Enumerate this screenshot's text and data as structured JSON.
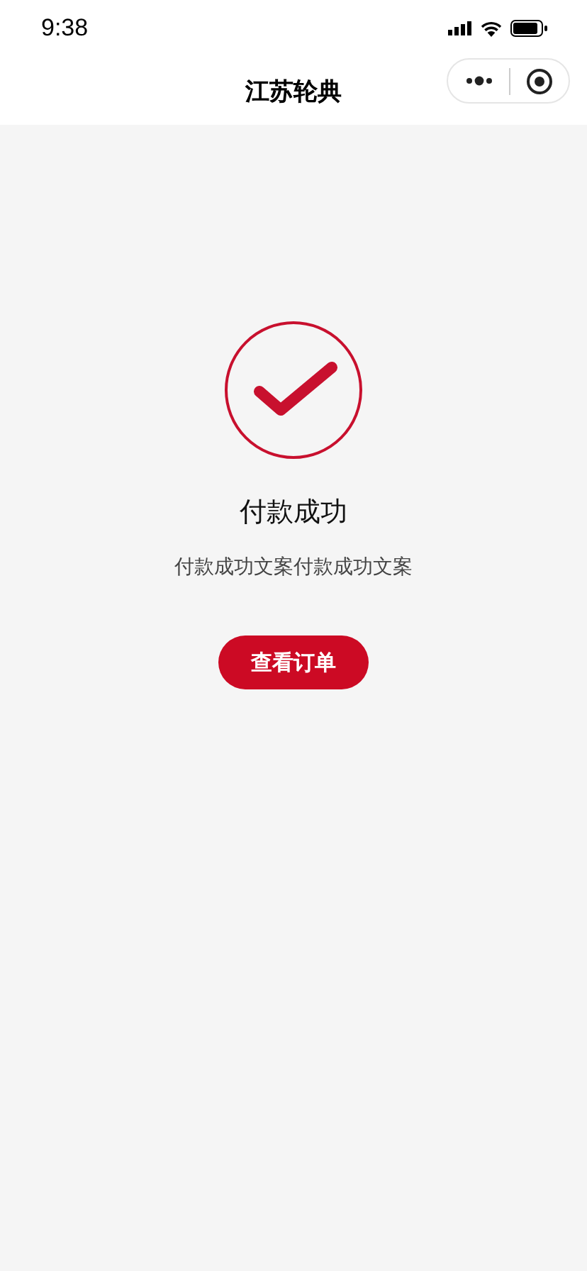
{
  "status_bar": {
    "time": "9:38"
  },
  "nav": {
    "title": "江苏轮典"
  },
  "result": {
    "title": "付款成功",
    "description": "付款成功文案付款成功文案",
    "button": "查看订单"
  }
}
